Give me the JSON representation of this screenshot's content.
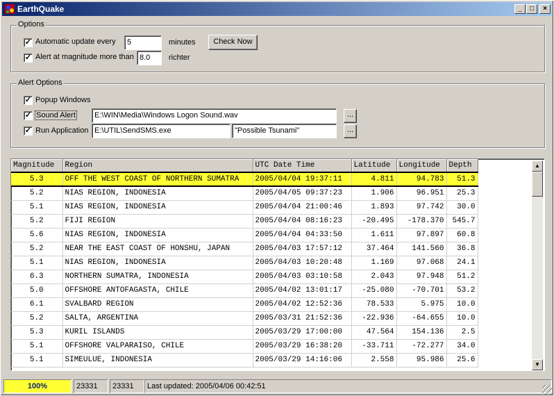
{
  "window": {
    "title": "EarthQuake"
  },
  "options": {
    "label": "Options",
    "auto_update_label": "Automatic update every",
    "auto_update_value": "5",
    "auto_update_unit": "minutes",
    "alert_mag_label": "Alert at magnitude more than",
    "alert_mag_value": "8.0",
    "alert_mag_unit": "richter",
    "check_now": "Check Now"
  },
  "alert_options": {
    "label": "Alert Options",
    "popup_label": "Popup Windows",
    "sound_label": "Sound Alert",
    "sound_path": "E:\\WIN\\Media\\Windows Logon Sound.wav",
    "run_label": "Run Application",
    "run_path": "E:\\UTIL\\SendSMS.exe",
    "run_args": "\"Possible Tsunami\"",
    "browse": "..."
  },
  "table": {
    "headers": [
      "Magnitude",
      "Region",
      "UTC Date Time",
      "Latitude",
      "Longitude",
      "Depth"
    ],
    "rows": [
      [
        "5.3",
        "OFF THE WEST COAST OF NORTHERN SUMATRA",
        "2005/04/04 19:37:11",
        "4.811",
        "94.783",
        "51.3"
      ],
      [
        "5.2",
        "NIAS REGION, INDONESIA",
        "2005/04/05 09:37:23",
        "1.906",
        "96.951",
        "25.3"
      ],
      [
        "5.1",
        "NIAS REGION, INDONESIA",
        "2005/04/04 21:00:46",
        "1.893",
        "97.742",
        "30.0"
      ],
      [
        "5.2",
        "FIJI REGION",
        "2005/04/04 08:16:23",
        "-20.495",
        "-178.370",
        "545.7"
      ],
      [
        "5.6",
        "NIAS REGION, INDONESIA",
        "2005/04/04 04:33:50",
        "1.611",
        "97.897",
        "60.8"
      ],
      [
        "5.2",
        "NEAR THE EAST COAST OF HONSHU, JAPAN",
        "2005/04/03 17:57:12",
        "37.464",
        "141.560",
        "36.8"
      ],
      [
        "5.1",
        "NIAS REGION, INDONESIA",
        "2005/04/03 10:20:48",
        "1.169",
        "97.068",
        "24.1"
      ],
      [
        "6.3",
        "NORTHERN SUMATRA, INDONESIA",
        "2005/04/03 03:10:58",
        "2.043",
        "97.948",
        "51.2"
      ],
      [
        "5.0",
        "OFFSHORE ANTOFAGASTA, CHILE",
        "2005/04/02 13:01:17",
        "-25.080",
        "-70.701",
        "53.2"
      ],
      [
        "6.1",
        "SVALBARD REGION",
        "2005/04/02 12:52:36",
        "78.533",
        "5.975",
        "10.0"
      ],
      [
        "5.2",
        "SALTA, ARGENTINA",
        "2005/03/31 21:52:36",
        "-22.936",
        "-64.655",
        "10.0"
      ],
      [
        "5.3",
        "KURIL ISLANDS",
        "2005/03/29 17:00:00",
        "47.564",
        "154.136",
        "2.5"
      ],
      [
        "5.1",
        "OFFSHORE VALPARAISO, CHILE",
        "2005/03/29 16:38:20",
        "-33.711",
        "-72.277",
        "34.0"
      ],
      [
        "5.1",
        "SIMEULUE, INDONESIA",
        "2005/03/29 14:16:06",
        "2.558",
        "95.986",
        "25.6"
      ]
    ]
  },
  "status": {
    "progress": "100%",
    "progress_color": "#ffff33",
    "count1": "23331",
    "count2": "23331",
    "last_updated": "Last updated: 2005/04/06 00:42:51"
  }
}
